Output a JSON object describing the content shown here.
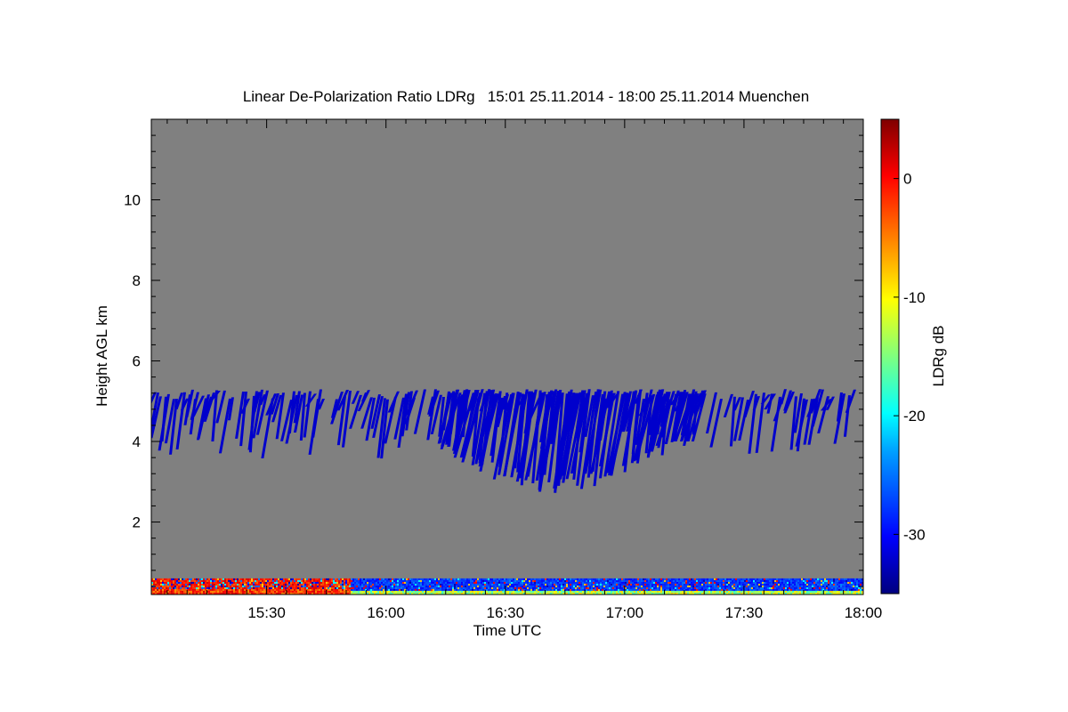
{
  "chart_data": {
    "type": "heatmap",
    "title": "Linear De-Polarization Ratio LDRg   15:01 25.11.2014 - 18:00 25.11.2014 Muenchen",
    "xlabel": "Time UTC",
    "ylabel": "Height AGL km",
    "x_range": [
      "15:01",
      "18:00"
    ],
    "xticks": [
      "15:30",
      "16:00",
      "16:30",
      "17:00",
      "17:30",
      "18:00"
    ],
    "ylim": [
      0.2,
      12.0
    ],
    "yticks": [
      2,
      4,
      6,
      8,
      10
    ],
    "colorbar": {
      "label": "LDRg dB",
      "range": [
        -35,
        5
      ],
      "ticks": [
        0,
        -10,
        -20,
        -30
      ],
      "colormap": "jet"
    },
    "no_signal_color": "#808080",
    "features": [
      {
        "name": "ice cloud layer",
        "ldr_db": -32,
        "time_start": "15:01",
        "time_end": "17:58",
        "base_km": 3.8,
        "top_km": 5.3
      },
      {
        "name": "fall streaks",
        "ldr_db": -32,
        "time_start": "16:15",
        "time_end": "17:20",
        "base_km": 2.7,
        "top_km": 5.3
      },
      {
        "name": "boundary layer aerosol",
        "ldr_db": -30,
        "time_start": "15:01",
        "time_end": "18:00",
        "base_km": 0.2,
        "top_km": 0.6
      }
    ]
  }
}
